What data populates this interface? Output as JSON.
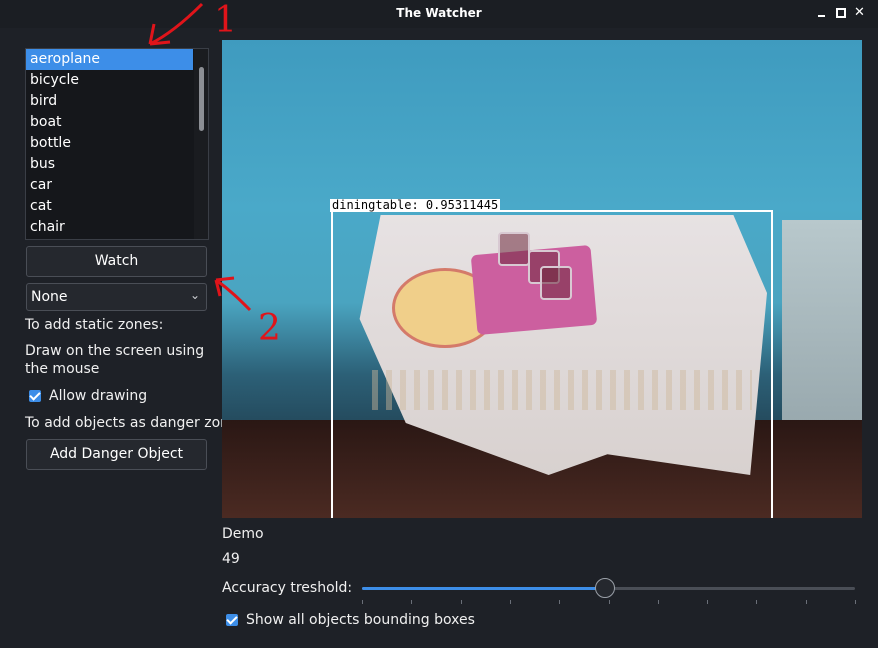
{
  "window": {
    "title": "The Watcher"
  },
  "class_list": {
    "items": [
      "aeroplane",
      "bicycle",
      "bird",
      "boat",
      "bottle",
      "bus",
      "car",
      "cat",
      "chair"
    ],
    "selected_index": 0
  },
  "watch_button": "Watch",
  "zone_dropdown": {
    "selected": "None"
  },
  "labels": {
    "static_zones": "To add static zones:",
    "draw_hint": "Draw on the screen using the mouse",
    "allow_drawing": "Allow drawing",
    "danger_objects": "To add objects as danger zones:"
  },
  "allow_drawing_checked": true,
  "add_danger_button": "Add Danger Object",
  "detection": {
    "label": "diningtable: 0.95311445"
  },
  "video": {
    "title": "Demo",
    "value": "49"
  },
  "accuracy": {
    "label": "Accuracy treshold:",
    "value": 49,
    "min": 0,
    "max": 100
  },
  "show_all_boxes": {
    "label": "Show all objects bounding boxes",
    "checked": true
  },
  "annotations": {
    "marker_1": "1",
    "marker_2": "2"
  },
  "colors": {
    "accent": "#3d8ee8",
    "background": "#1e2127",
    "annotation": "#e0141a"
  }
}
